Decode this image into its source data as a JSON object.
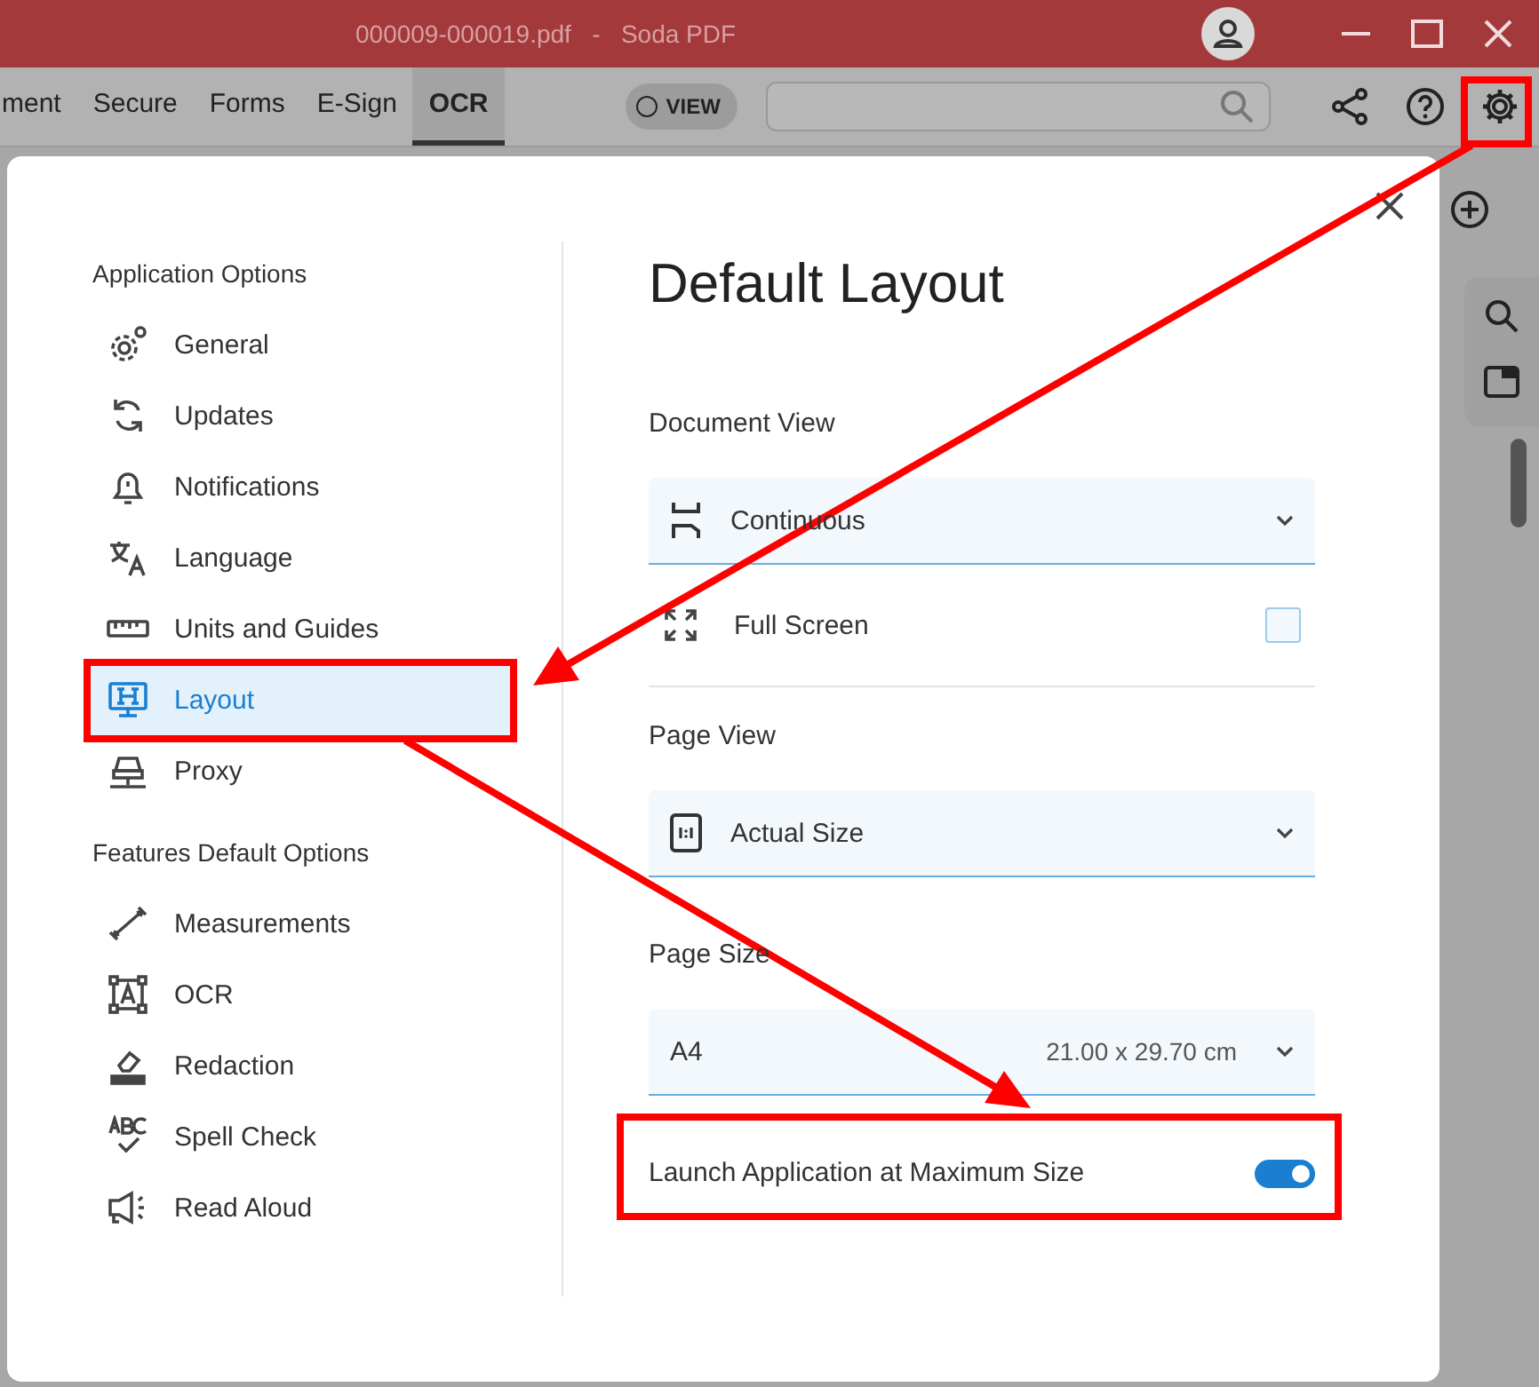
{
  "window": {
    "title": "000009-000019.pdf   -   Soda PDF"
  },
  "toolbar": {
    "tabs": [
      {
        "label": "ment",
        "selected": false
      },
      {
        "label": "Secure",
        "selected": false
      },
      {
        "label": "Forms",
        "selected": false
      },
      {
        "label": "E-Sign",
        "selected": false
      },
      {
        "label": "OCR",
        "selected": true
      }
    ],
    "view_toggle": {
      "label": "VIEW",
      "on": false
    }
  },
  "dialog": {
    "title": "Default Layout",
    "sections": [
      {
        "title": "Application Options",
        "items": [
          {
            "label": "General",
            "selected": false
          },
          {
            "label": "Updates",
            "selected": false
          },
          {
            "label": "Notifications",
            "selected": false
          },
          {
            "label": "Language",
            "selected": false
          },
          {
            "label": "Units and Guides",
            "selected": false
          },
          {
            "label": "Layout",
            "selected": true
          },
          {
            "label": "Proxy",
            "selected": false
          }
        ]
      },
      {
        "title": "Features Default Options",
        "items": [
          {
            "label": "Measurements",
            "selected": false
          },
          {
            "label": "OCR",
            "selected": false
          },
          {
            "label": "Redaction",
            "selected": false
          },
          {
            "label": "Spell Check",
            "selected": false
          },
          {
            "label": "Read Aloud",
            "selected": false
          }
        ]
      }
    ],
    "document_view": {
      "label": "Document View",
      "value": "Continuous",
      "full_screen": {
        "label": "Full Screen",
        "checked": false
      }
    },
    "page_view": {
      "label": "Page View",
      "value": "Actual Size"
    },
    "page_size": {
      "label": "Page Size",
      "value": "A4",
      "dimensions": "21.00 x 29.70 cm"
    },
    "launch_maximized": {
      "label": "Launch Application at Maximum Size",
      "on": true
    }
  }
}
